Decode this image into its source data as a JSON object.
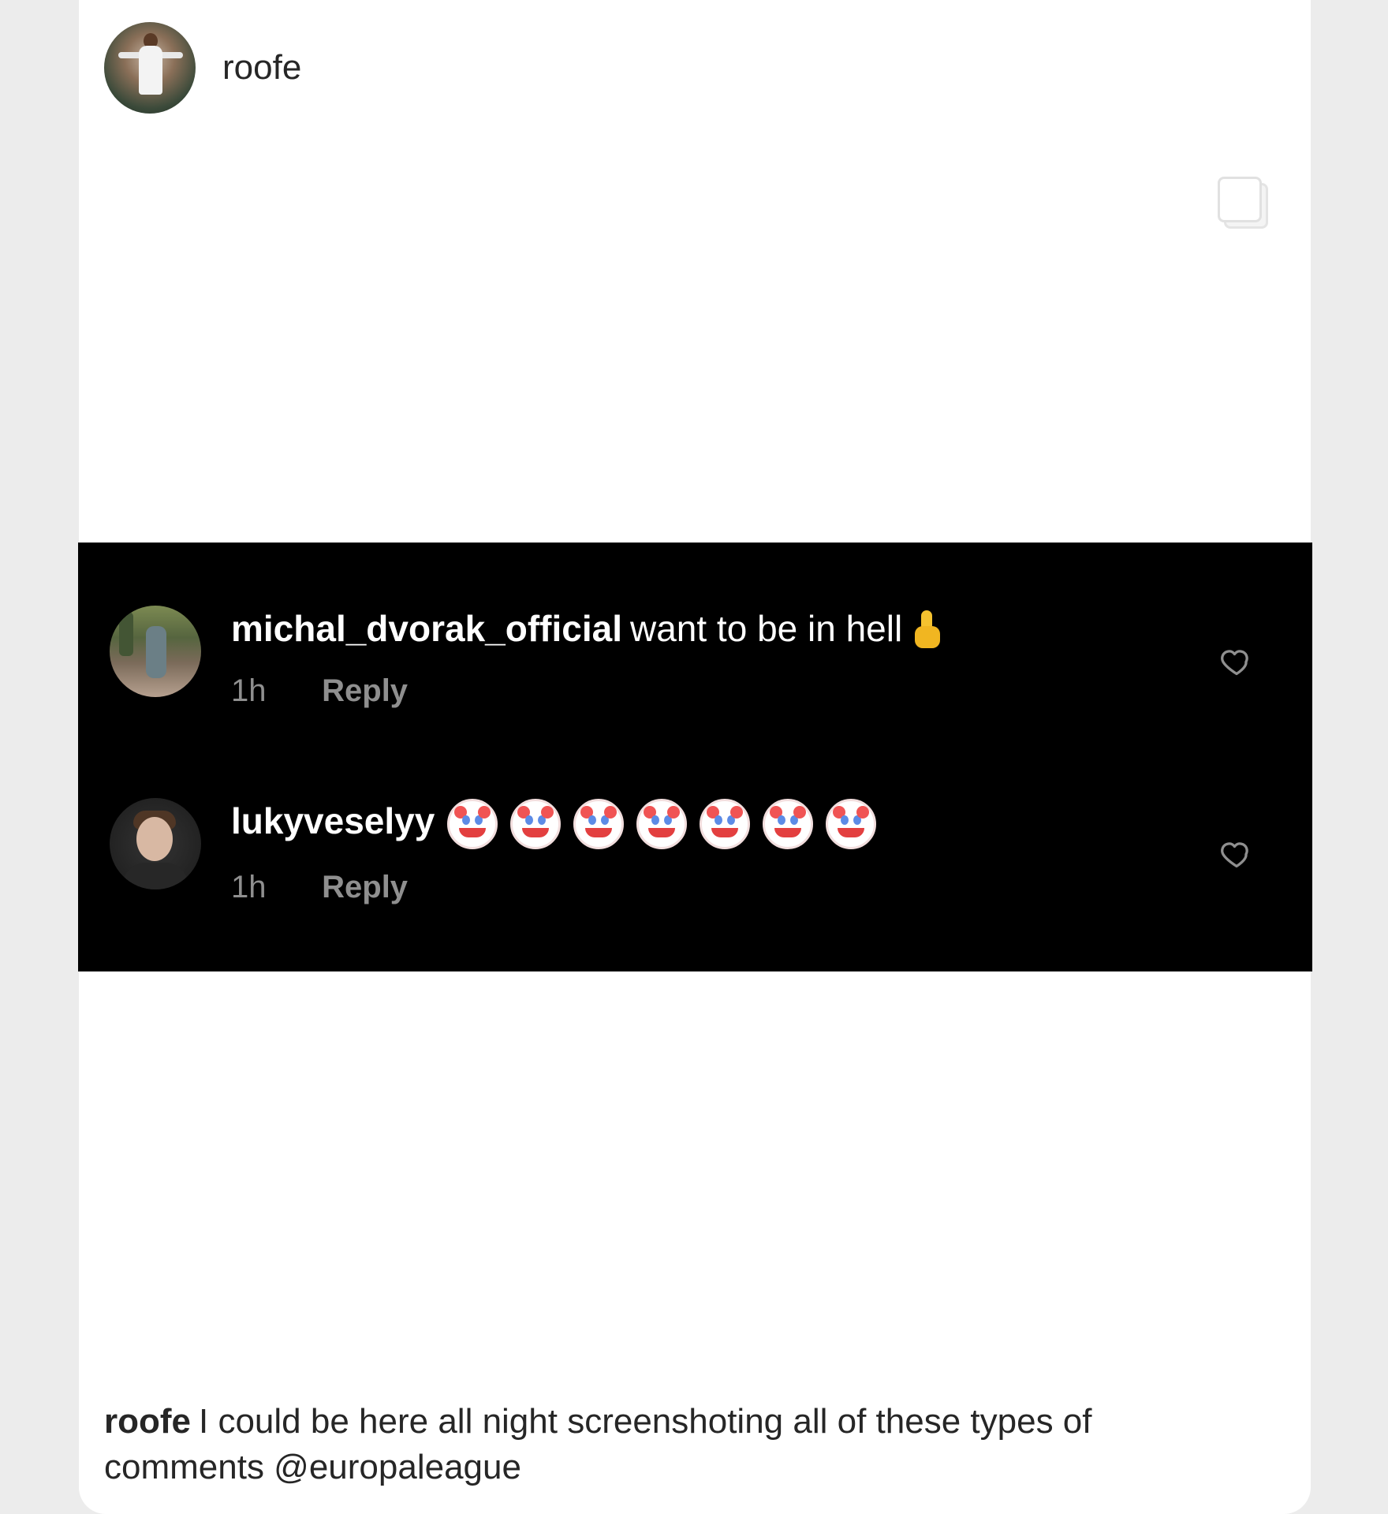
{
  "post": {
    "username": "roofe",
    "icons": {
      "avatar": "profile-avatar",
      "media": "multiple-media-icon"
    }
  },
  "comments": [
    {
      "username": "michal_dvorak_official",
      "text": "want to be in hell",
      "emoji": "middle-finger-emoji",
      "time": "1h",
      "reply": "Reply",
      "like_icon": "heart-icon"
    },
    {
      "username": "lukyveselyy",
      "text": "",
      "emoji": "clown-face-emoji",
      "emoji_count": 7,
      "time": "1h",
      "reply": "Reply",
      "like_icon": "heart-icon"
    }
  ],
  "caption": {
    "username": "roofe",
    "text": "I could be here all night screenshoting all of these types of comments @europaleague"
  },
  "colors": {
    "panel_background": "#000000",
    "page_background": "#ffffff",
    "text_dark": "#262626",
    "meta_gray": "#8f8f8f"
  }
}
